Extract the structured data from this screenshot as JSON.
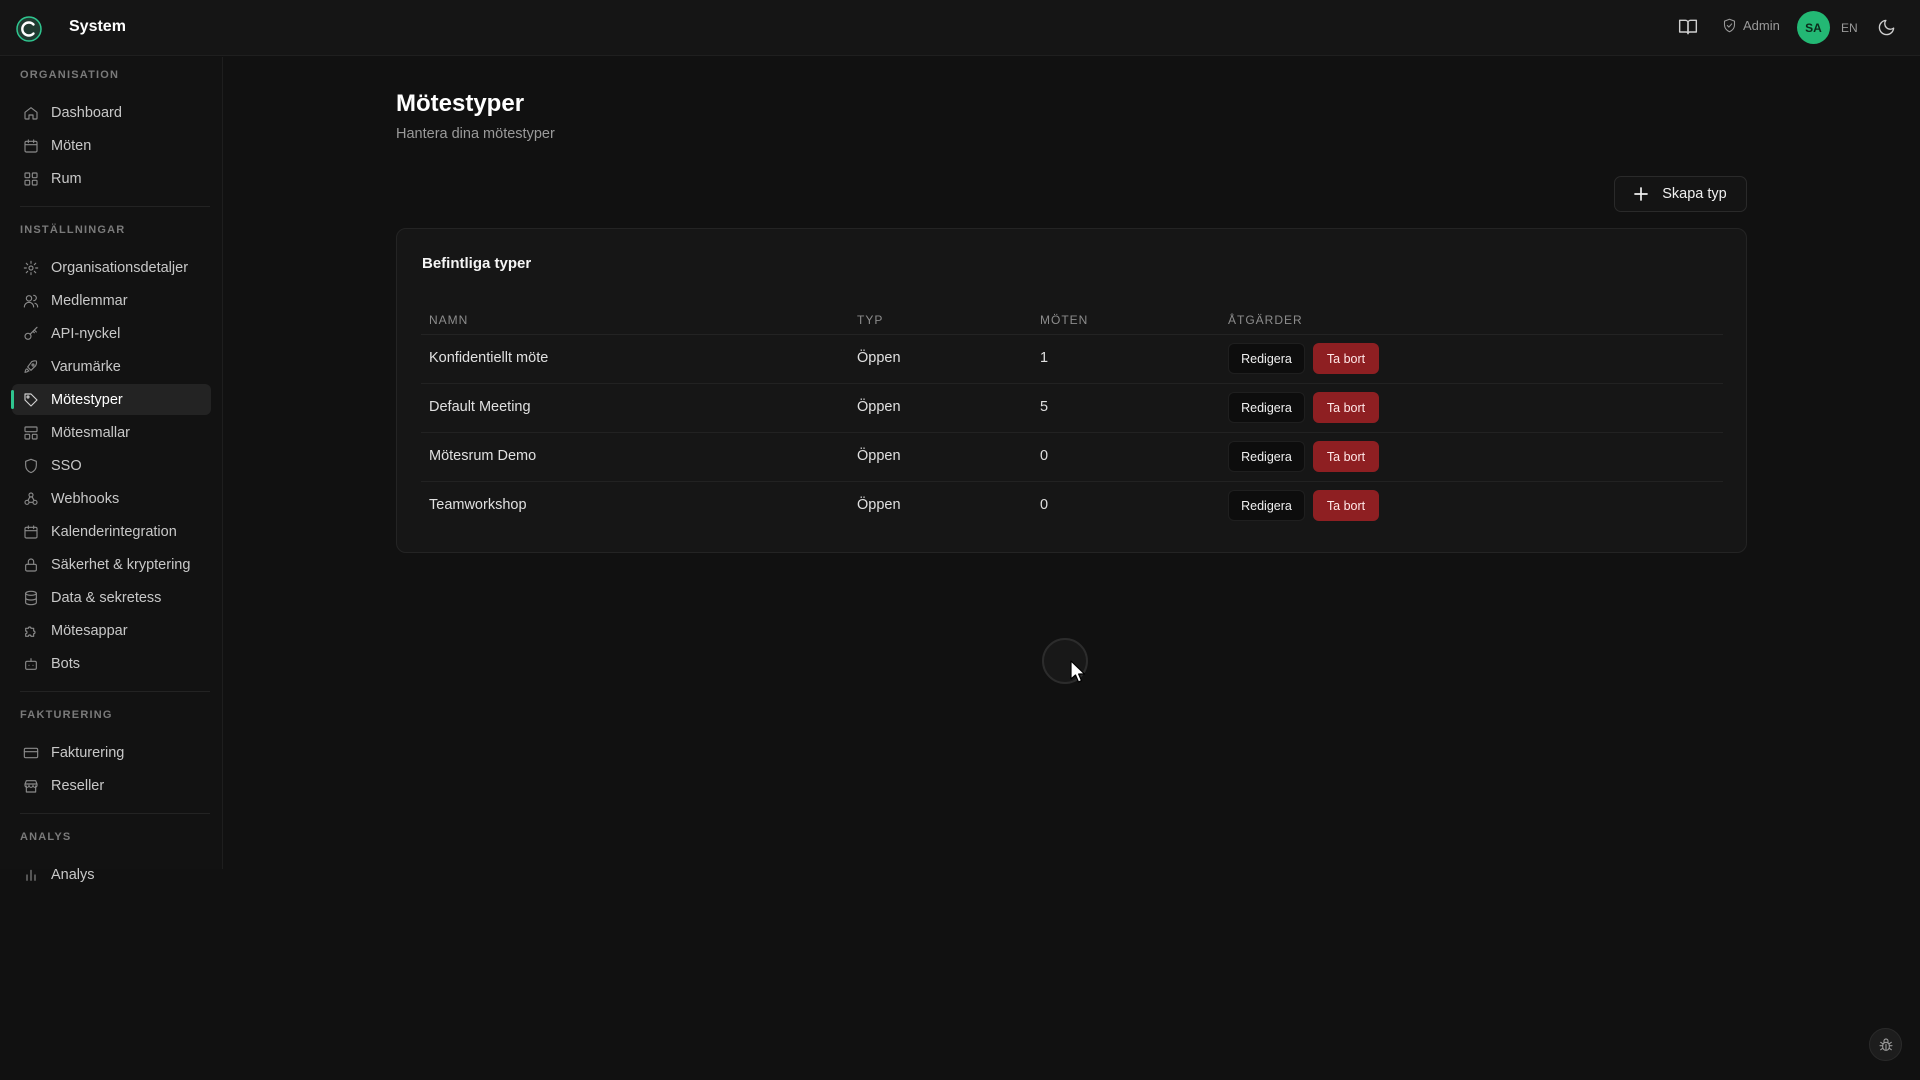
{
  "app": {
    "title": "System"
  },
  "header": {
    "admin_label": "Admin",
    "avatar_initials": "SA",
    "language": "EN",
    "icons": [
      "book-icon",
      "shield-check-icon",
      "moon-icon"
    ]
  },
  "sidebar": {
    "sections": [
      {
        "label": "ORGANISATION",
        "items": [
          {
            "label": "Dashboard",
            "icon": "home-icon"
          },
          {
            "label": "Möten",
            "icon": "calendar-icon"
          },
          {
            "label": "Rum",
            "icon": "grid-icon"
          }
        ]
      },
      {
        "label": "INSTÄLLNINGAR",
        "items": [
          {
            "label": "Organisationsdetaljer",
            "icon": "gear-icon"
          },
          {
            "label": "Medlemmar",
            "icon": "users-icon"
          },
          {
            "label": "API-nyckel",
            "icon": "key-icon"
          },
          {
            "label": "Varumärke",
            "icon": "rocket-icon"
          },
          {
            "label": "Mötestyper",
            "icon": "tag-icon",
            "active": true
          },
          {
            "label": "Mötesmallar",
            "icon": "template-icon"
          },
          {
            "label": "SSO",
            "icon": "shield-icon"
          },
          {
            "label": "Webhooks",
            "icon": "webhook-icon"
          },
          {
            "label": "Kalenderintegration",
            "icon": "calendar-icon"
          },
          {
            "label": "Säkerhet & kryptering",
            "icon": "lock-icon"
          },
          {
            "label": "Data & sekretess",
            "icon": "database-icon"
          },
          {
            "label": "Mötesappar",
            "icon": "puzzle-icon"
          },
          {
            "label": "Bots",
            "icon": "bot-icon"
          }
        ]
      },
      {
        "label": "FAKTURERING",
        "items": [
          {
            "label": "Fakturering",
            "icon": "credit-card-icon"
          },
          {
            "label": "Reseller",
            "icon": "store-icon"
          }
        ]
      },
      {
        "label": "ANALYS",
        "items": [
          {
            "label": "Analys",
            "icon": "bar-chart-icon"
          }
        ]
      }
    ]
  },
  "main": {
    "title": "Mötestyper",
    "subtitle": "Hantera dina mötestyper",
    "create_button": "Skapa typ",
    "card_title": "Befintliga typer",
    "table": {
      "headers": [
        "NAMN",
        "TYP",
        "MÖTEN",
        "ÅTGÄRDER"
      ],
      "rows": [
        {
          "name": "Konfidentiellt möte",
          "type": "Öppen",
          "meetings": "1"
        },
        {
          "name": "Default Meeting",
          "type": "Öppen",
          "meetings": "5"
        },
        {
          "name": "Mötesrum Demo",
          "type": "Öppen",
          "meetings": "0"
        },
        {
          "name": "Teamworkshop",
          "type": "Öppen",
          "meetings": "0"
        }
      ],
      "edit_label": "Redigera",
      "delete_label": "Ta bort"
    }
  },
  "colors": {
    "accent": "#2fc58f",
    "avatar": "#23b874",
    "danger": "#8e1f22",
    "background": "#111111"
  }
}
